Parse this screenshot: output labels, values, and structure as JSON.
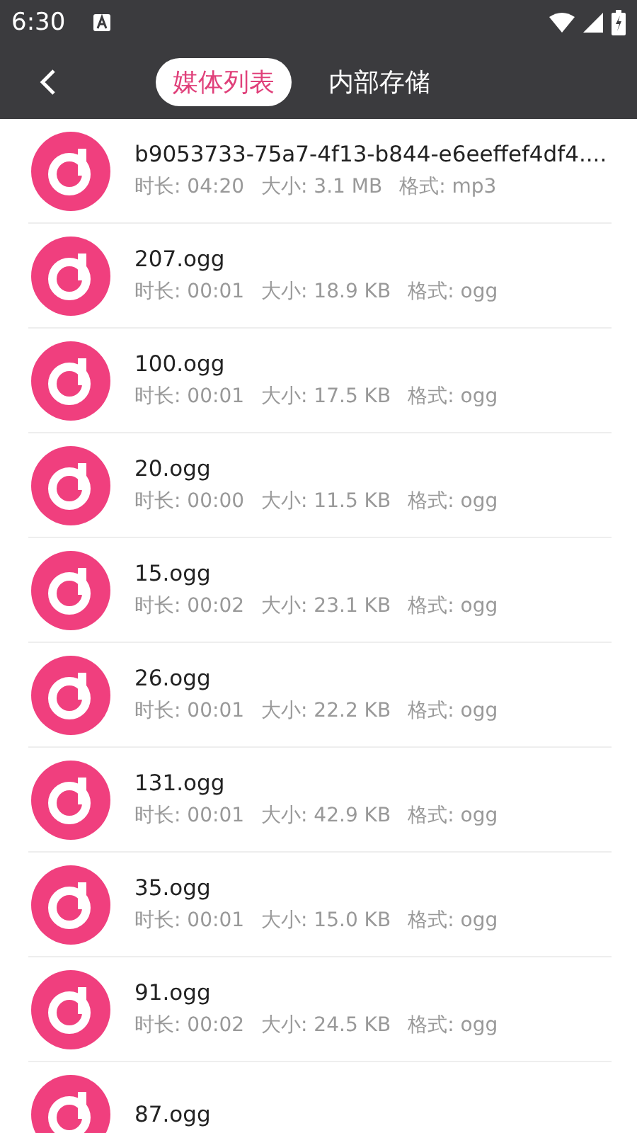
{
  "status_bar": {
    "time": "6:30"
  },
  "tabs": [
    {
      "label": "媒体列表",
      "selected": true
    },
    {
      "label": "内部存储",
      "selected": false
    }
  ],
  "files": [
    {
      "name": "b9053733-75a7-4f13-b844-e6eeffef4df4....",
      "duration": "时长: 04:20",
      "size": "大小: 3.1 MB",
      "format": "格式: mp3"
    },
    {
      "name": "207.ogg",
      "duration": "时长: 00:01",
      "size": "大小: 18.9 KB",
      "format": "格式: ogg"
    },
    {
      "name": "100.ogg",
      "duration": "时长: 00:01",
      "size": "大小: 17.5 KB",
      "format": "格式: ogg"
    },
    {
      "name": "20.ogg",
      "duration": "时长: 00:00",
      "size": "大小: 11.5 KB",
      "format": "格式: ogg"
    },
    {
      "name": "15.ogg",
      "duration": "时长: 00:02",
      "size": "大小: 23.1 KB",
      "format": "格式: ogg"
    },
    {
      "name": "26.ogg",
      "duration": "时长: 00:01",
      "size": "大小: 22.2 KB",
      "format": "格式: ogg"
    },
    {
      "name": "131.ogg",
      "duration": "时长: 00:01",
      "size": "大小: 42.9 KB",
      "format": "格式: ogg"
    },
    {
      "name": "35.ogg",
      "duration": "时长: 00:01",
      "size": "大小: 15.0 KB",
      "format": "格式: ogg"
    },
    {
      "name": "91.ogg",
      "duration": "时长: 00:02",
      "size": "大小: 24.5 KB",
      "format": "格式: ogg"
    },
    {
      "name": "87.ogg"
    }
  ]
}
